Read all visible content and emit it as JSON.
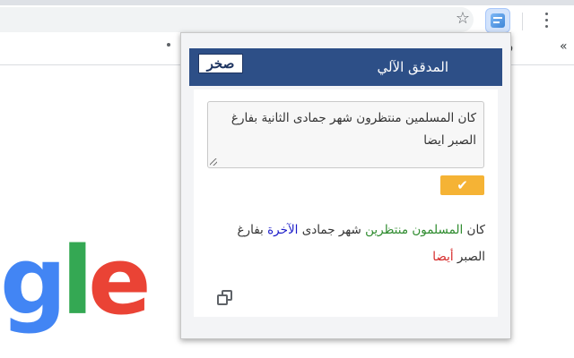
{
  "browser": {
    "bookmark_stub": "و",
    "chevron": "«",
    "star_glyph": "☆"
  },
  "background": {
    "logo_letters": [
      "g",
      "l",
      "e"
    ],
    "logo_colors": [
      "#4285f4",
      "#34a853",
      "#ea4335"
    ]
  },
  "popup": {
    "title": "المدقق الآلي",
    "logo_text": "صخر",
    "header_color": "#2d4f87",
    "input_text": "كان المسلمين منتظرون شهر جمادى الثانية بفارغ الصبر ايضا",
    "check_button_glyph": "✔",
    "check_button_color": "#f5b335",
    "result": {
      "words": [
        {
          "text": "كان",
          "status": "ok"
        },
        {
          "text": "المسلمون",
          "status": "corrected-grammar"
        },
        {
          "text": "منتظرين",
          "status": "corrected-grammar"
        },
        {
          "text": "شهر",
          "status": "ok"
        },
        {
          "text": "جمادى",
          "status": "ok"
        },
        {
          "text": "الآخرة",
          "status": "corrected-semantic"
        },
        {
          "text": "بفارغ",
          "status": "ok"
        },
        {
          "text": "الصبر",
          "status": "ok"
        },
        {
          "text": "أيضا",
          "status": "corrected-spelling"
        }
      ],
      "colors": {
        "corrected-grammar": "#2e8b2e",
        "corrected-semantic": "#1a1ac8",
        "corrected-spelling": "#d62828"
      }
    }
  }
}
